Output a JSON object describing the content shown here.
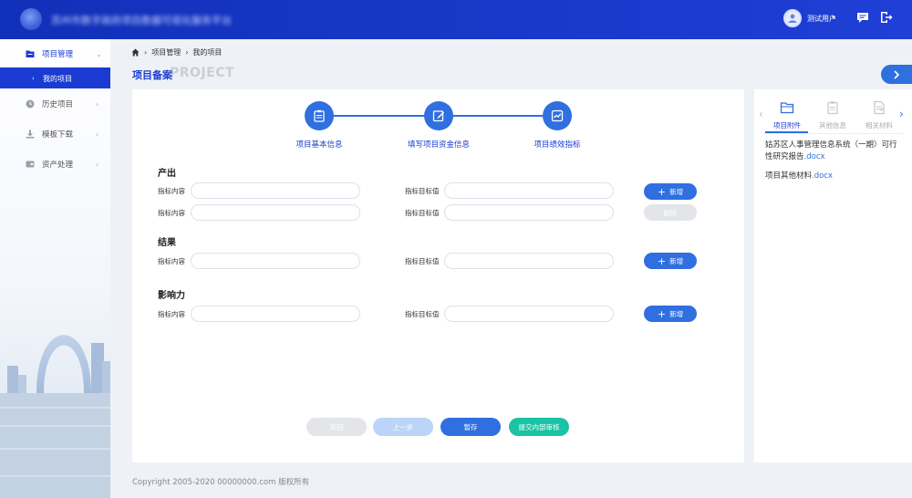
{
  "header": {
    "brand_title": "苏州市数字政府项目数据可视化服务平台",
    "user_name": "测试用户",
    "caret": "▾",
    "icons": {
      "logo": "logo-icon",
      "message": "message-icon",
      "logout": "logout-icon"
    }
  },
  "sidebar": {
    "items": [
      {
        "label": "项目管理",
        "icon": "folder-icon",
        "arrow": "⌄",
        "active": true
      },
      {
        "label": "历史项目",
        "icon": "clock-icon",
        "arrow": "›"
      },
      {
        "label": "模板下载",
        "icon": "download-icon",
        "arrow": "›"
      },
      {
        "label": "资产处理",
        "icon": "asset-icon",
        "arrow": "›"
      }
    ],
    "sub_item": {
      "label": "我的项目",
      "bullet": "›"
    }
  },
  "breadcrumb": {
    "sep": "›",
    "items": [
      "项目管理",
      "我的项目"
    ]
  },
  "page": {
    "title": "项目备案",
    "title_bg": "PROJECT"
  },
  "steps": [
    {
      "label": "项目基本信息",
      "icon": "clipboard-icon"
    },
    {
      "label": "填写项目资金信息",
      "icon": "edit-icon"
    },
    {
      "label": "项目绩效指标",
      "icon": "chart-icon"
    }
  ],
  "form": {
    "content_label": "指标内容",
    "target_label": "指标目标值",
    "add_label": "新增",
    "add_plus": "+",
    "delete_label": "删除",
    "sections": [
      {
        "title": "产出"
      },
      {
        "title": "结果"
      },
      {
        "title": "影响力"
      }
    ]
  },
  "footer_buttons": {
    "back": "返回",
    "prev": "上一步",
    "save": "暂存",
    "submit": "提交内部审核"
  },
  "right_panel": {
    "prev_arrow": "‹",
    "next_arrow": "›",
    "tabs": [
      {
        "label": "项目附件",
        "icon": "folder-icon",
        "active": true
      },
      {
        "label": "其他信息",
        "icon": "clipboard-icon"
      },
      {
        "label": "相关材料",
        "icon": "document-icon"
      }
    ],
    "files": [
      {
        "name": "姑苏区人事管理信息系统（一期）可行性研究报告",
        "ext": ".docx"
      },
      {
        "name": "项目其他材料",
        "ext": ".docx"
      }
    ]
  },
  "copyright": "Copyright 2005-2020 00000000.com 版权所有",
  "colors": {
    "primary": "#2f6fe0",
    "header": "#1130b9",
    "submit": "#19c3a3"
  }
}
